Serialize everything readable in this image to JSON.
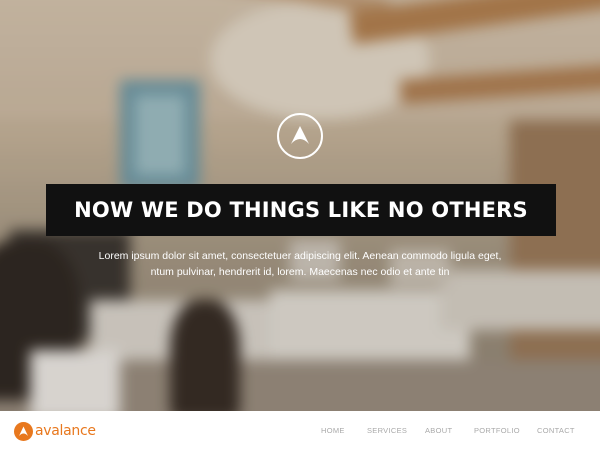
{
  "hero": {
    "headline": "NOW WE DO THINGS LIKE NO OTHERS",
    "subtitle_line1": "Lorem ipsum dolor sit amet, consectetuer adipiscing elit. Aenean commodo ligula eget,",
    "subtitle_line2": "ntum pulvinar, hendrerit id, lorem. Maecenas nec odio et ante tin",
    "logo_icon": "caret-up-circle-icon",
    "background": "blurred-office-photo"
  },
  "navbar": {
    "brand_name": "avalance",
    "brand_icon": "caret-up-circle-icon",
    "items": [
      {
        "label": "HOME"
      },
      {
        "label": "SERVICES"
      },
      {
        "label": "ABOUT"
      },
      {
        "label": "PORTFOLIO"
      },
      {
        "label": "CONTACT"
      }
    ]
  },
  "colors": {
    "accent": "#e8781e",
    "headline_bg": "#111111",
    "nav_text": "#a9a9a9",
    "text_light": "#ffffff"
  }
}
